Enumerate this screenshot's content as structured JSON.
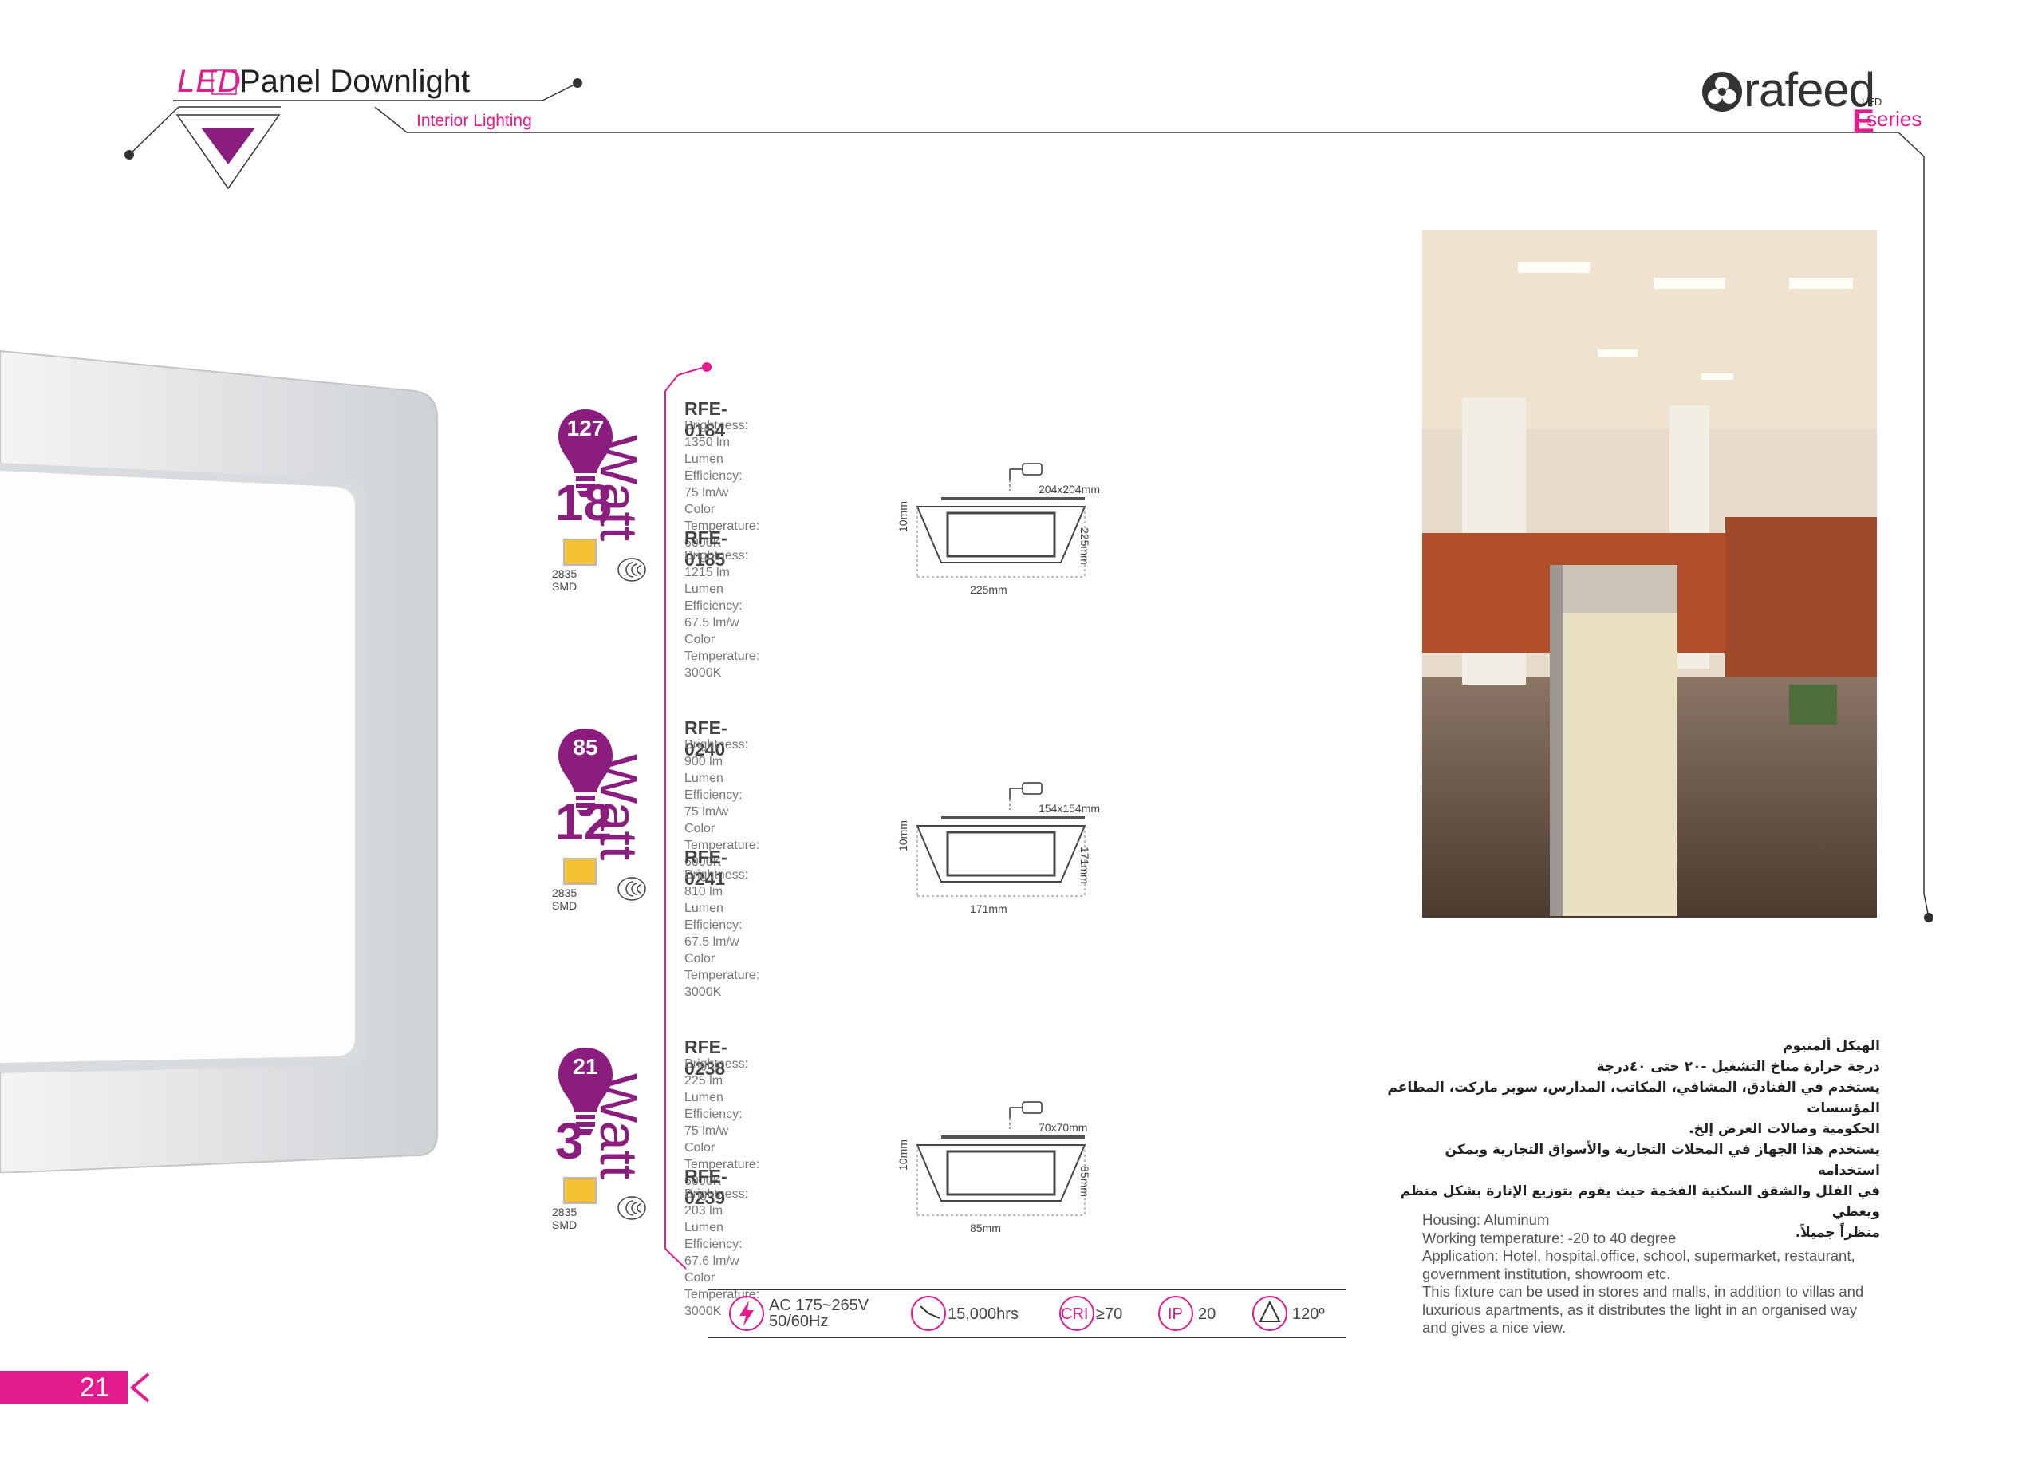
{
  "header": {
    "led": "LED",
    "title": "Panel Downlight",
    "subtitle": "Interior Lighting"
  },
  "brand": {
    "name": "rafeed",
    "led": "LED",
    "e": "E",
    "series": "series"
  },
  "colors": {
    "accent": "#e31b8d",
    "purple": "#8a1d7d",
    "chip": "#f5c233"
  },
  "groups": [
    {
      "equiv": "127",
      "watt": "18",
      "watt_word": "Watt",
      "smd": "2835 SMD",
      "models": [
        {
          "code": "RFE-0184",
          "brightness": "Brightness: 1350 lm",
          "efficiency": "Lumen Efficiency: 75 lm/w",
          "temp": "Color Temperature: 6000K"
        },
        {
          "code": "RFE-0185",
          "brightness": "Brightness: 1215 lm",
          "efficiency": "Lumen Efficiency: 67.5 lm/w",
          "temp": "Color Temperature: 3000K"
        }
      ],
      "cutout": "204x204mm",
      "depth": "10mm",
      "width": "225mm",
      "height": "225mm"
    },
    {
      "equiv": "85",
      "watt": "12",
      "watt_word": "Watt",
      "smd": "2835 SMD",
      "models": [
        {
          "code": "RFE-0240",
          "brightness": "Brightness: 900 lm",
          "efficiency": "Lumen Efficiency: 75 lm/w",
          "temp": "Color Temperature: 6000K"
        },
        {
          "code": "RFE-0241",
          "brightness": "Brightness: 810 lm",
          "efficiency": "Lumen Efficiency: 67.5 lm/w",
          "temp": "Color Temperature: 3000K"
        }
      ],
      "cutout": "154x154mm",
      "depth": "10mm",
      "width": "171mm",
      "height": "171mm"
    },
    {
      "equiv": "21",
      "watt": "3",
      "watt_word": "Watt",
      "smd": "2835 SMD",
      "models": [
        {
          "code": "RFE-0238",
          "brightness": "Brightness: 225 lm",
          "efficiency": "Lumen Efficiency: 75 lm/w",
          "temp": "Color Temperature: 6000K"
        },
        {
          "code": "RFE-0239",
          "brightness": "Brightness: 203 lm",
          "efficiency": "Lumen Efficiency: 67.6 lm/w",
          "temp": "Color Temperature: 3000K"
        }
      ],
      "cutout": "70x70mm",
      "depth": "10mm",
      "width": "85mm",
      "height": "85mm"
    }
  ],
  "features": {
    "voltage_1": "AC 175~265V",
    "voltage_2": "50/60Hz",
    "hours": "15,000hrs",
    "cri_label": "CRI",
    "cri_value": "≥70",
    "ip_label": "IP",
    "ip_value": "20",
    "angle": "120º"
  },
  "description_ar": [
    "الهيكل ألمنيوم",
    "درجة حرارة مناخ التشغيل -٢٠ حتى ٤٠درجة",
    "يستخدم في الفنادق، المشافي، المكاتب، المدارس، سوبر ماركت، المطاعم المؤسسات",
    "الحكومية وصالات العرض إلخ.",
    "يستخدم هذا الجهاز في المحلات التجارية والأسواق التجارية ويمكن استخدامه",
    "في الفلل والشقق السكنية الفخمة حيث يقوم بتوزيع الإنارة بشكل منظم ويعطي",
    "منظراً جميلاً."
  ],
  "description_en": [
    "Housing: Aluminum",
    "Working temperature: -20 to 40 degree",
    "Application: Hotel, hospital,office, school, supermarket, restaurant, government institution, showroom etc.",
    "This fixture can be used in stores and malls, in addition to villas and luxurious apartments, as it distributes the light in an organised way and gives a nice view."
  ],
  "page_number": "21"
}
